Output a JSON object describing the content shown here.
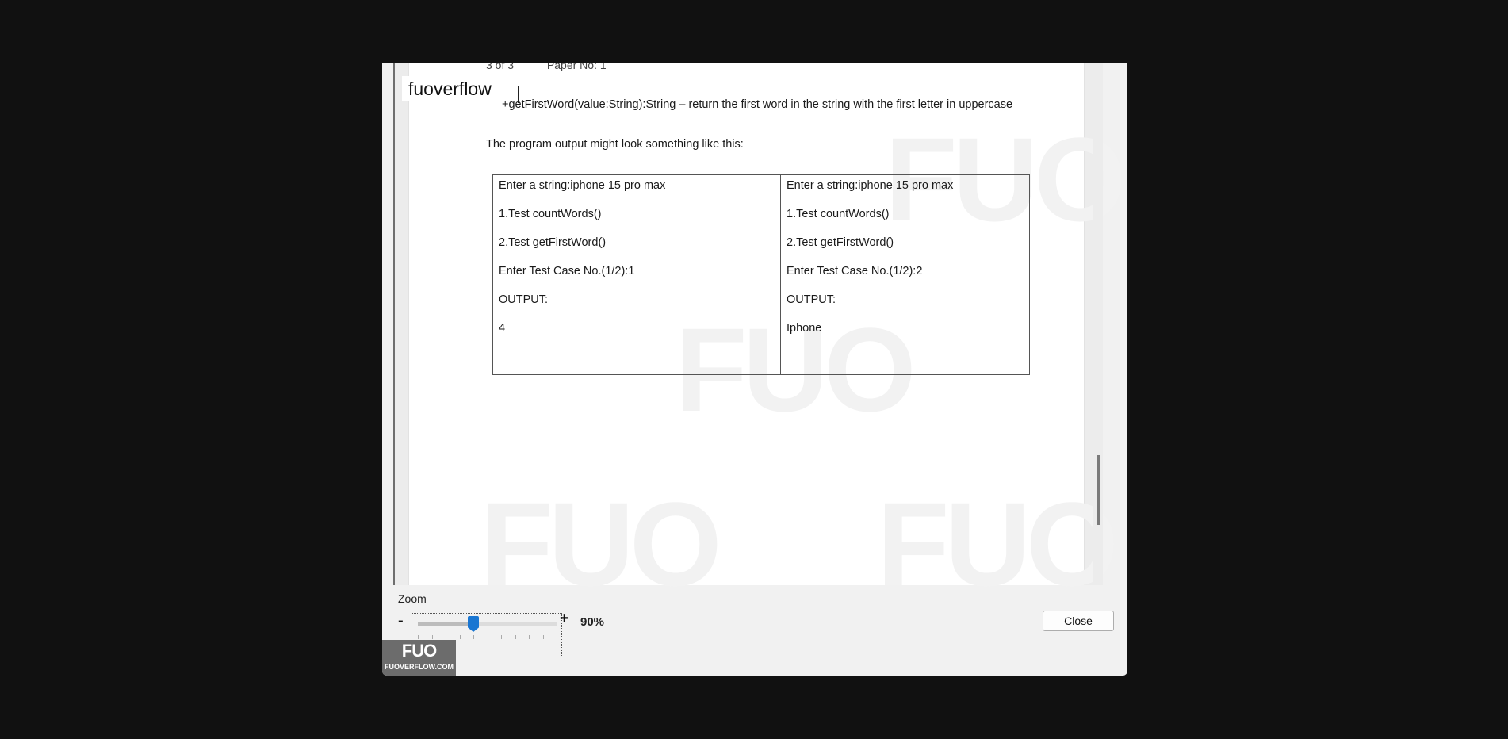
{
  "viewer": {
    "brand": "fuoverflow",
    "header_cut": [
      "3 of 3",
      "Paper No: 1"
    ],
    "method_line": "+getFirstWord(value:String):String – return the first word in the string with the first letter in uppercase",
    "intro": "The program output might look something like this:",
    "example": {
      "left": [
        "Enter a string:iphone 15 pro max",
        "1.Test countWords()",
        "2.Test getFirstWord()",
        "Enter Test Case No.(1/2):1",
        "OUTPUT:",
        "4"
      ],
      "right": [
        "Enter a string:iphone 15 pro max",
        "1.Test countWords()",
        "2.Test getFirstWord()",
        "Enter Test Case No.(1/2):2",
        "OUTPUT:",
        "Iphone"
      ]
    },
    "scroll_position": 0.92
  },
  "zoom": {
    "label": "Zoom",
    "minus": "-",
    "plus": "+",
    "value": "90%",
    "slider_fraction": 0.4
  },
  "close_label": "Close",
  "badge": {
    "logo": "FUO",
    "site": "FUOVERFLOW.COM"
  },
  "colors": {
    "accent": "#1976d2",
    "backdrop": "#111111",
    "dialog": "#f1f1f1"
  }
}
